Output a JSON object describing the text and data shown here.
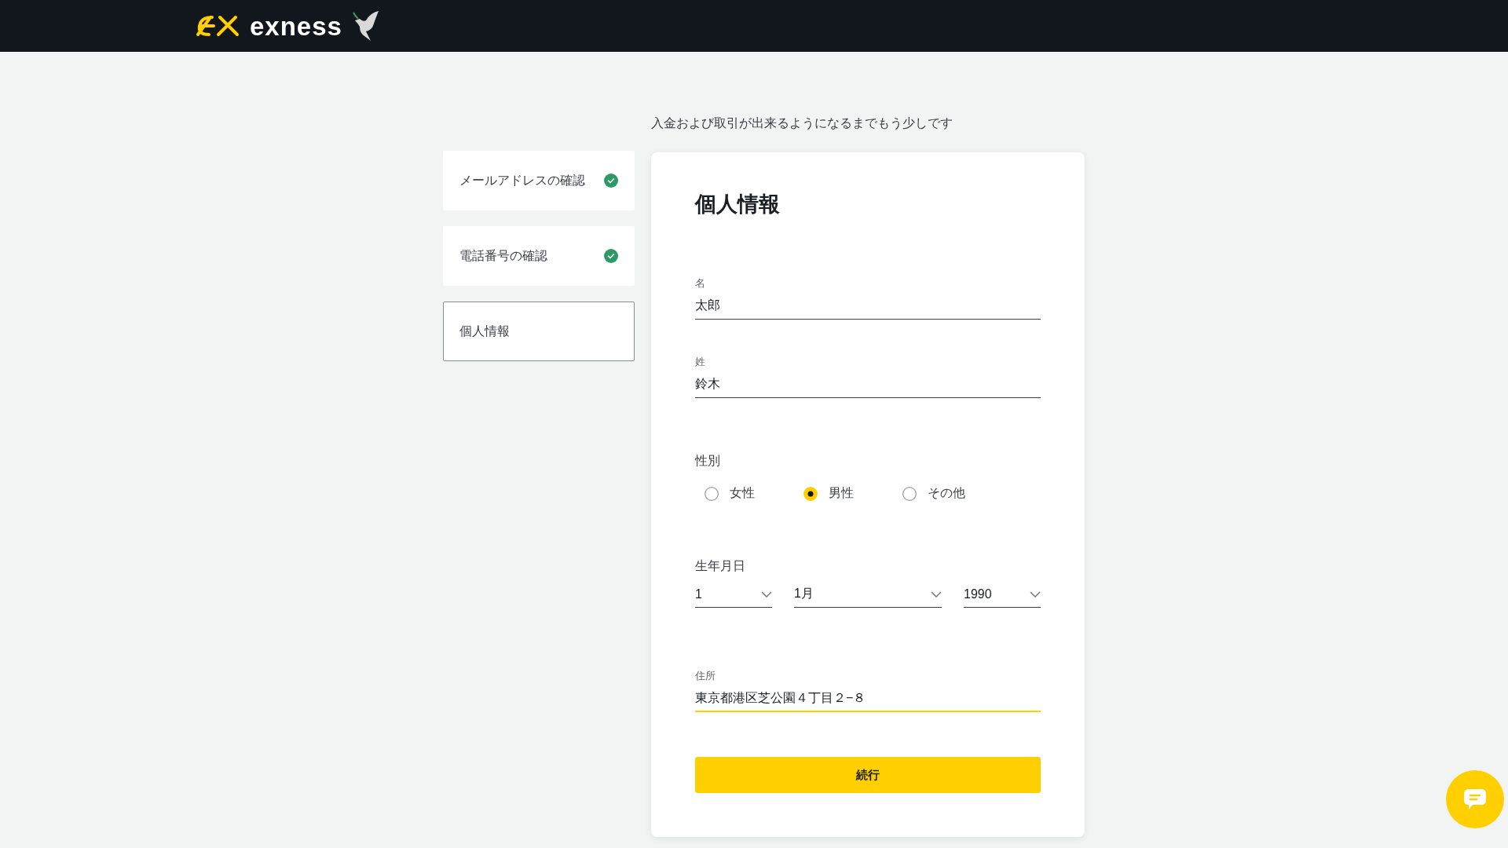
{
  "header": {
    "logo_text": "exness"
  },
  "subtitle": "入金および取引が出来るようになるまでもう少しです",
  "steps": [
    {
      "label": "メールアドレスの確認",
      "completed": true,
      "selected": false
    },
    {
      "label": "電話番号の確認",
      "completed": true,
      "selected": false
    },
    {
      "label": "個人情報",
      "completed": false,
      "selected": true
    }
  ],
  "form": {
    "title": "個人情報",
    "fields": [
      {
        "kind": "text",
        "label": "名",
        "value": "太郎",
        "focused": false
      },
      {
        "kind": "text",
        "label": "姓",
        "value": "鈴木",
        "focused": false
      },
      {
        "kind": "radio",
        "label": "性別",
        "options": [
          {
            "label": "女性",
            "selected": false
          },
          {
            "label": "男性",
            "selected": true
          },
          {
            "label": "その他",
            "selected": false
          }
        ]
      },
      {
        "kind": "date",
        "label": "生年月日",
        "selects": [
          {
            "value": "1"
          },
          {
            "value": "1月"
          },
          {
            "value": "1990"
          }
        ]
      },
      {
        "kind": "text",
        "label": "住所",
        "value": "東京都港区芝公園４丁目２−８",
        "focused": true
      }
    ],
    "submit": "続行"
  }
}
